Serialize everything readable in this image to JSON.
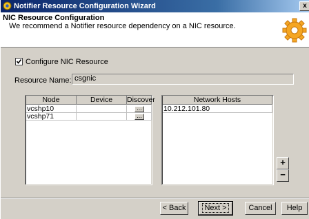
{
  "window": {
    "title": "Notifier Resource Configuration Wizard",
    "close_label": "x"
  },
  "header": {
    "title": "NIC Resource Configuration",
    "subtitle": "We recommend a Notifier resource dependency on a NIC resource."
  },
  "configure_nic": {
    "label": "Configure NIC Resource",
    "checked": true
  },
  "resource_name": {
    "label": "Resource Name:",
    "value": "csgnic"
  },
  "node_table": {
    "columns": [
      "Node",
      "Device",
      "Discover"
    ],
    "rows": [
      {
        "node": "vcshp10",
        "device": "",
        "discover": "..."
      },
      {
        "node": "vcshp71",
        "device": "",
        "discover": "..."
      }
    ]
  },
  "hosts_table": {
    "columns": [
      "Network Hosts"
    ],
    "rows": [
      "10.212.101.80"
    ]
  },
  "side_buttons": {
    "add": "+",
    "remove": "−"
  },
  "footer": {
    "back": "< Back",
    "next": "Next >",
    "cancel": "Cancel",
    "help": "Help"
  }
}
